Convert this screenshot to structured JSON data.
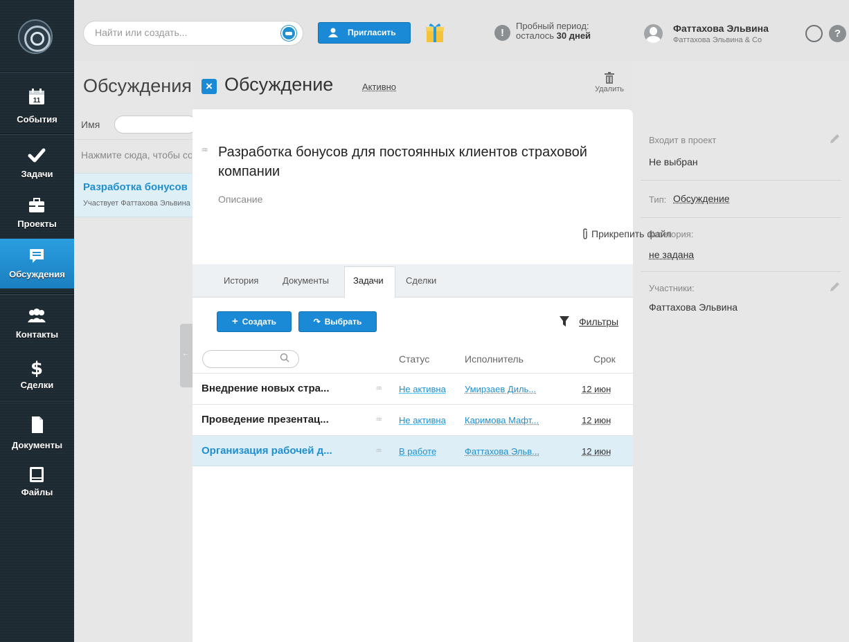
{
  "topbar": {
    "search_placeholder": "Найти или создать...",
    "invite_label": "Пригласить",
    "trial_line1": "Пробный период:",
    "trial_line2_prefix": "осталось",
    "trial_days": "30 дней",
    "user_name": "Фаттахова Эльвина",
    "user_company": "Фаттахова Эльвина & Co",
    "help_glyph": "?",
    "trial_glyph": "!"
  },
  "sidebar": {
    "calendar_day": "11",
    "items": [
      {
        "label": "События",
        "icon": "calendar-icon"
      },
      {
        "label": "Задачи",
        "icon": "checkmark-icon"
      },
      {
        "label": "Проекты",
        "icon": "briefcase-icon"
      },
      {
        "label": "Обсуждения",
        "icon": "chat-bubble-icon"
      },
      {
        "label": "Контакты",
        "icon": "people-icon"
      },
      {
        "label": "Сделки",
        "icon": "dollar-icon"
      },
      {
        "label": "Документы",
        "icon": "document-icon"
      },
      {
        "label": "Файлы",
        "icon": "file-tray-icon"
      }
    ],
    "active_index": 3,
    "colors": {
      "background": "#1e2a32",
      "active": "#1f8fd0"
    }
  },
  "background_view": {
    "title": "Обсуждения",
    "name_label": "Имя",
    "hint": "Нажмите сюда, чтобы создать",
    "item_title": "Разработка бонусов",
    "item_subtitle": "Участвует Фаттахова Эльвина"
  },
  "panel": {
    "close_glyph": "×",
    "title": "Обсуждение",
    "status": "Активно",
    "delete_label": "Удалить",
    "discussion_title": "Разработка бонусов для постоянных клиентов страховой компании",
    "description_label": "Описание",
    "attach_label": "Прикрепить файл",
    "tabs": [
      {
        "label": "История"
      },
      {
        "label": "Документы"
      },
      {
        "label": "Задачи"
      },
      {
        "label": "Сделки"
      }
    ],
    "active_tab": "Задачи",
    "create_label": "Создать",
    "select_label": "Выбрать",
    "filters_label": "Фильтры",
    "columns": {
      "status": "Статус",
      "owner": "Исполнитель",
      "due": "Срок"
    },
    "tasks": [
      {
        "name": "Внедрение новых стра...",
        "status": "Не активна",
        "owner": "Умирзаев Диль...",
        "due": "12 июн",
        "selected": false
      },
      {
        "name": "Проведение презентац...",
        "status": "Не активна",
        "owner": "Каримова Мафт...",
        "due": "12 июн",
        "selected": false
      },
      {
        "name": "Организация рабочей д...",
        "status": "В работе",
        "owner": "Фаттахова Эльв...",
        "due": "12 июн",
        "selected": true
      }
    ]
  },
  "info": {
    "project_label": "Входит в проект",
    "project_value": "Не выбран",
    "type_label": "Тип:",
    "type_value": "Обсуждение",
    "category_label": "Категория:",
    "category_value": "не задана",
    "participants_label": "Участники:",
    "participants_value": "Фаттахова Эльвина"
  },
  "colors": {
    "accent": "#1a8ad6",
    "link": "#1f8fd0",
    "selected_row": "#deeef6"
  }
}
